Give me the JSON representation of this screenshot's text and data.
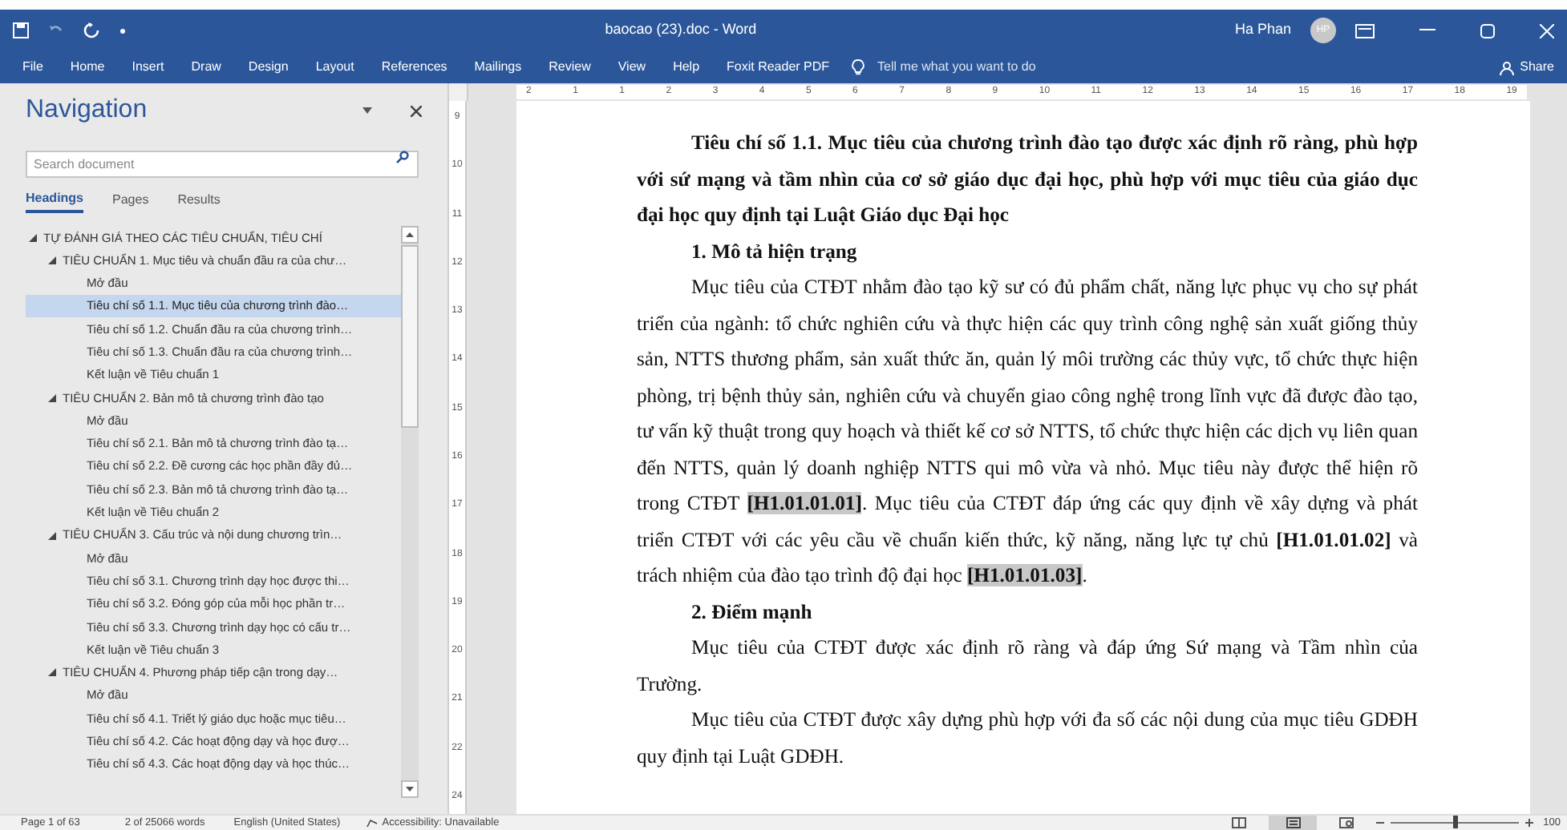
{
  "window": {
    "title": "baocao (23).doc - Word",
    "user": "Ha Phan",
    "avatar": "HP"
  },
  "ribbon_tabs": [
    {
      "label": "File",
      "selected": false
    },
    {
      "label": "Home",
      "selected": false
    },
    {
      "label": "Insert",
      "selected": false
    },
    {
      "label": "Draw",
      "selected": false
    },
    {
      "label": "Design",
      "selected": false
    },
    {
      "label": "Layout",
      "selected": false
    },
    {
      "label": "References",
      "selected": false
    },
    {
      "label": "Mailings",
      "selected": false
    },
    {
      "label": "Review",
      "selected": false
    },
    {
      "label": "View",
      "selected": false
    },
    {
      "label": "Help",
      "selected": false
    },
    {
      "label": "Foxit Reader PDF",
      "selected": false
    }
  ],
  "tell_me": {
    "placeholder": "Tell me what you want to do"
  },
  "share": "Share",
  "navigation": {
    "title": "Navigation",
    "search": {
      "placeholder": "Search document"
    },
    "tabs": [
      {
        "label": "Headings",
        "selected": true
      },
      {
        "label": "Pages",
        "selected": false
      },
      {
        "label": "Results",
        "selected": false
      }
    ],
    "tree": [
      {
        "label": "TỰ ĐÁNH GIÁ THEO CÁC TIÊU CHUẨN, TIÊU CHÍ",
        "expanded": true,
        "selected": false,
        "children": [
          {
            "label": "TIÊU CHUẨN 1. Mục tiêu và chuẩn đầu ra của chư…",
            "expanded": true,
            "selected": false,
            "children": [
              {
                "label": "Mở đầu",
                "selected": false
              },
              {
                "label": "Tiêu chí số 1.1. Mục tiêu của chương trình đào…",
                "selected": true
              },
              {
                "label": "Tiêu chí số 1.2. Chuẩn đầu ra của chương trình…",
                "selected": false
              },
              {
                "label": "Tiêu chí số 1.3. Chuẩn đầu ra của chương trình…",
                "selected": false
              },
              {
                "label": "Kết luận về Tiêu chuẩn 1",
                "selected": false
              }
            ]
          },
          {
            "label": "TIÊU CHUẨN 2. Bản mô tả chương trình đào tạo",
            "expanded": true,
            "selected": false,
            "children": [
              {
                "label": "Mở đầu",
                "selected": false
              },
              {
                "label": "Tiêu chí số 2.1. Bản mô tả chương trình đào tạ…",
                "selected": false
              },
              {
                "label": "Tiêu chí số 2.2. Đề cương các học phần đầy đủ…",
                "selected": false
              },
              {
                "label": "Tiêu chí số 2.3. Bản mô tả chương trình đào tạ…",
                "selected": false
              },
              {
                "label": "Kết luận về Tiêu chuẩn 2",
                "selected": false
              }
            ]
          },
          {
            "label": "TIÊU CHUẨN 3. Cấu trúc và nội dung chương trìn…",
            "expanded": true,
            "selected": false,
            "children": [
              {
                "label": "Mở đầu",
                "selected": false
              },
              {
                "label": "Tiêu chí số 3.1. Chương trình dạy học được thi…",
                "selected": false
              },
              {
                "label": "Tiêu chí số 3.2. Đóng góp của mỗi học phần tr…",
                "selected": false
              },
              {
                "label": "Tiêu chí số 3.3. Chương trình dạy học có cấu tr…",
                "selected": false
              },
              {
                "label": "Kết luận về Tiêu chuẩn 3",
                "selected": false
              }
            ]
          },
          {
            "label": "TIÊU CHUẨN 4. Phương pháp tiếp cận trong dạy…",
            "expanded": true,
            "selected": false,
            "children": [
              {
                "label": "Mở đầu",
                "selected": false
              },
              {
                "label": "Tiêu chí số 4.1. Triết lý giáo dục hoặc mục tiêu…",
                "selected": false
              },
              {
                "label": "Tiêu chí số 4.2. Các hoạt động dạy và học đượ…",
                "selected": false
              },
              {
                "label": "Tiêu chí số 4.3. Các hoạt động dạy và học thúc…",
                "selected": false
              }
            ]
          }
        ]
      }
    ]
  },
  "ruler": {
    "horizontal": [
      "2",
      "1",
      "1",
      "2",
      "3",
      "4",
      "5",
      "6",
      "7",
      "8",
      "9",
      "10",
      "11",
      "12",
      "13",
      "14",
      "15",
      "16",
      "17",
      "18",
      "19"
    ],
    "vertical": [
      "9",
      "10",
      "11",
      "12",
      "13",
      "14",
      "15",
      "16",
      "17",
      "18",
      "19",
      "20",
      "21",
      "22",
      "24"
    ]
  },
  "document": {
    "paragraphs": [
      {
        "kind": "heading",
        "text": "Tiêu chí số 1.1. Mục tiêu của chương trình đào tạo được xác định rõ ràng, phù hợp với sứ mạng và tầm nhìn của cơ sở giáo dục đại học, phù hợp với mục tiêu của giáo dục đại học quy định tại Luật Giáo dục Đại học"
      },
      {
        "kind": "subheading",
        "text": "1. Mô tả hiện trạng"
      },
      {
        "kind": "body",
        "runs": [
          {
            "text": "Mục tiêu của CTĐT nhằm đào tạo kỹ sư có đủ phẩm chất, năng lực phục vụ cho sự phát triển của ngành: tổ chức nghiên cứu và thực hiện các quy trình công nghệ sản xuất giống thủy sản, NTTS thương phẩm, sản xuất thức ăn, quản lý môi trường các thủy vực, tổ chức thực hiện phòng, trị bệnh thủy sản, nghiên cứu và chuyển giao công nghệ trong lĩnh vực đã được đào tạo, tư vấn kỹ thuật trong quy hoạch và thiết kế cơ sở NTTS, tổ chức thực hiện các dịch vụ liên quan đến NTTS, quản lý doanh nghiệp NTTS qui mô vừa và nhỏ. Mục tiêu này được thể hiện rõ trong CTĐT ",
            "bold": false,
            "highlighted": false
          },
          {
            "text": "[H1.01.01.01]",
            "bold": true,
            "highlighted": true
          },
          {
            "text": ". Mục tiêu của CTĐT đáp ứng các quy định về xây dựng và phát triển CTĐT với các yêu cầu về chuẩn kiến thức, kỹ năng, năng lực tự chủ ",
            "bold": false,
            "highlighted": false
          },
          {
            "text": "[H1.01.01.02]",
            "bold": true,
            "highlighted": false
          },
          {
            "text": " và trách nhiệm của đào tạo trình độ đại học ",
            "bold": false,
            "highlighted": false
          },
          {
            "text": "[H1.01.01.03]",
            "bold": true,
            "highlighted": true
          },
          {
            "text": ".",
            "bold": false,
            "highlighted": false
          }
        ]
      },
      {
        "kind": "subheading",
        "text": "2. Điểm mạnh"
      },
      {
        "kind": "body",
        "runs": [
          {
            "text": "Mục tiêu của CTĐT được xác định rõ ràng và đáp ứng Sứ mạng và Tầm nhìn của Trường.",
            "bold": false,
            "highlighted": false
          }
        ]
      },
      {
        "kind": "body",
        "runs": [
          {
            "text": "Mục tiêu của CTĐT được xây dựng phù hợp với đa số các nội dung của mục tiêu GDĐH quy định tại Luật GDĐH.",
            "bold": false,
            "highlighted": false
          }
        ]
      }
    ]
  },
  "status_bar": {
    "page": "Page 1 of 63",
    "words": "2 of 25066 words",
    "language": "English (United States)",
    "accessibility": "Accessibility: Unavailable",
    "zoom": {
      "level": 0.5,
      "reading": "100"
    }
  }
}
